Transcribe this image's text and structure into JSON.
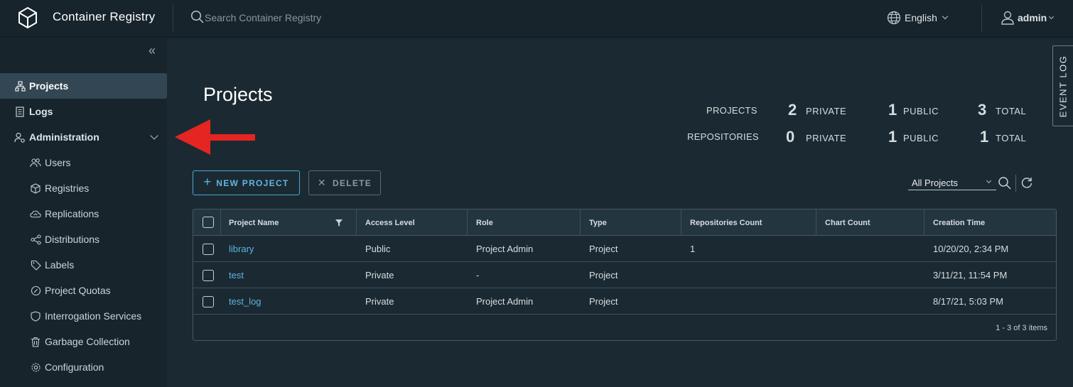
{
  "header": {
    "app_title": "Container Registry",
    "search_placeholder": "Search Container Registry",
    "language": "English",
    "user": "admin"
  },
  "sidebar": {
    "items": [
      {
        "label": "Projects",
        "icon": "projects-icon"
      },
      {
        "label": "Logs",
        "icon": "logs-icon"
      },
      {
        "label": "Administration",
        "icon": "administration-icon"
      }
    ],
    "admin_items": [
      {
        "label": "Users",
        "icon": "users-icon"
      },
      {
        "label": "Registries",
        "icon": "registries-icon"
      },
      {
        "label": "Replications",
        "icon": "replications-icon"
      },
      {
        "label": "Distributions",
        "icon": "distributions-icon"
      },
      {
        "label": "Labels",
        "icon": "labels-icon"
      },
      {
        "label": "Project Quotas",
        "icon": "project-quotas-icon"
      },
      {
        "label": "Interrogation Services",
        "icon": "interrogation-services-icon"
      },
      {
        "label": "Garbage Collection",
        "icon": "garbage-collection-icon"
      },
      {
        "label": "Configuration",
        "icon": "configuration-icon"
      }
    ]
  },
  "event_log": "EVENT LOG",
  "main": {
    "title": "Projects",
    "stats": {
      "projects_label": "PROJECTS",
      "repositories_label": "REPOSITORIES",
      "private_label": "PRIVATE",
      "public_label": "PUBLIC",
      "total_label": "TOTAL",
      "projects": {
        "private": "2",
        "public": "1",
        "total": "3"
      },
      "repositories": {
        "private": "0",
        "public": "1",
        "total": "1"
      }
    },
    "new_project": "NEW PROJECT",
    "delete": "DELETE",
    "filter": "All Projects",
    "table": {
      "columns": [
        "Project Name",
        "Access Level",
        "Role",
        "Type",
        "Repositories Count",
        "Chart Count",
        "Creation Time"
      ],
      "rows": [
        {
          "name": "library",
          "access": "Public",
          "role": "Project Admin",
          "type": "Project",
          "repos": "1",
          "charts": "",
          "created": "10/20/20, 2:34 PM"
        },
        {
          "name": "test",
          "access": "Private",
          "role": "-",
          "type": "Project",
          "repos": "",
          "charts": "",
          "created": "3/11/21, 11:54 PM"
        },
        {
          "name": "test_log",
          "access": "Private",
          "role": "Project Admin",
          "type": "Project",
          "repos": "",
          "charts": "",
          "created": "8/17/21, 5:03 PM"
        }
      ],
      "pager": "1 - 3 of 3 items"
    }
  },
  "colors": {
    "accent": "#4aa7d8",
    "arrow": "#e52521",
    "background": "#1b2a32",
    "header": "#17242b"
  }
}
